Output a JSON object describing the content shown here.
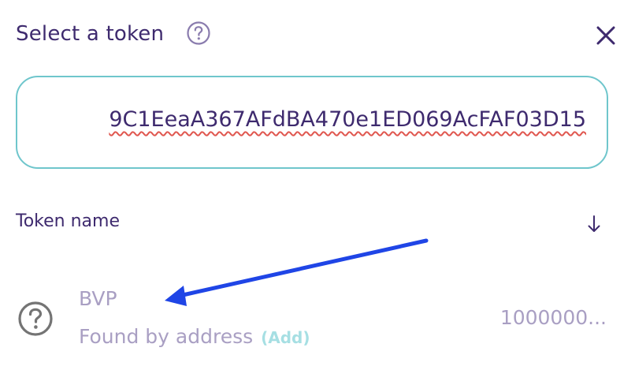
{
  "header": {
    "title": "Select a token",
    "help_icon": "question-circle-icon",
    "close_icon": "close-icon"
  },
  "search": {
    "value": "9C1EeaA367AFdBA470e1ED069AcFAF03D15"
  },
  "list": {
    "header_label": "Token name",
    "sort_icon": "arrow-down-icon",
    "tokens": [
      {
        "symbol": "BVP",
        "subtitle": "Found by address",
        "add_label": "(Add)",
        "balance": "1000000...",
        "icon": "question-circle-icon"
      }
    ]
  },
  "annotation": {
    "arrow_color": "#1f45e6"
  },
  "colors": {
    "title": "#3e2a6e",
    "border_accent": "#6fc6cc",
    "muted_text": "#a99fc3",
    "add_link": "#a6dfe3",
    "spellcheck_underline": "#e0574f"
  }
}
